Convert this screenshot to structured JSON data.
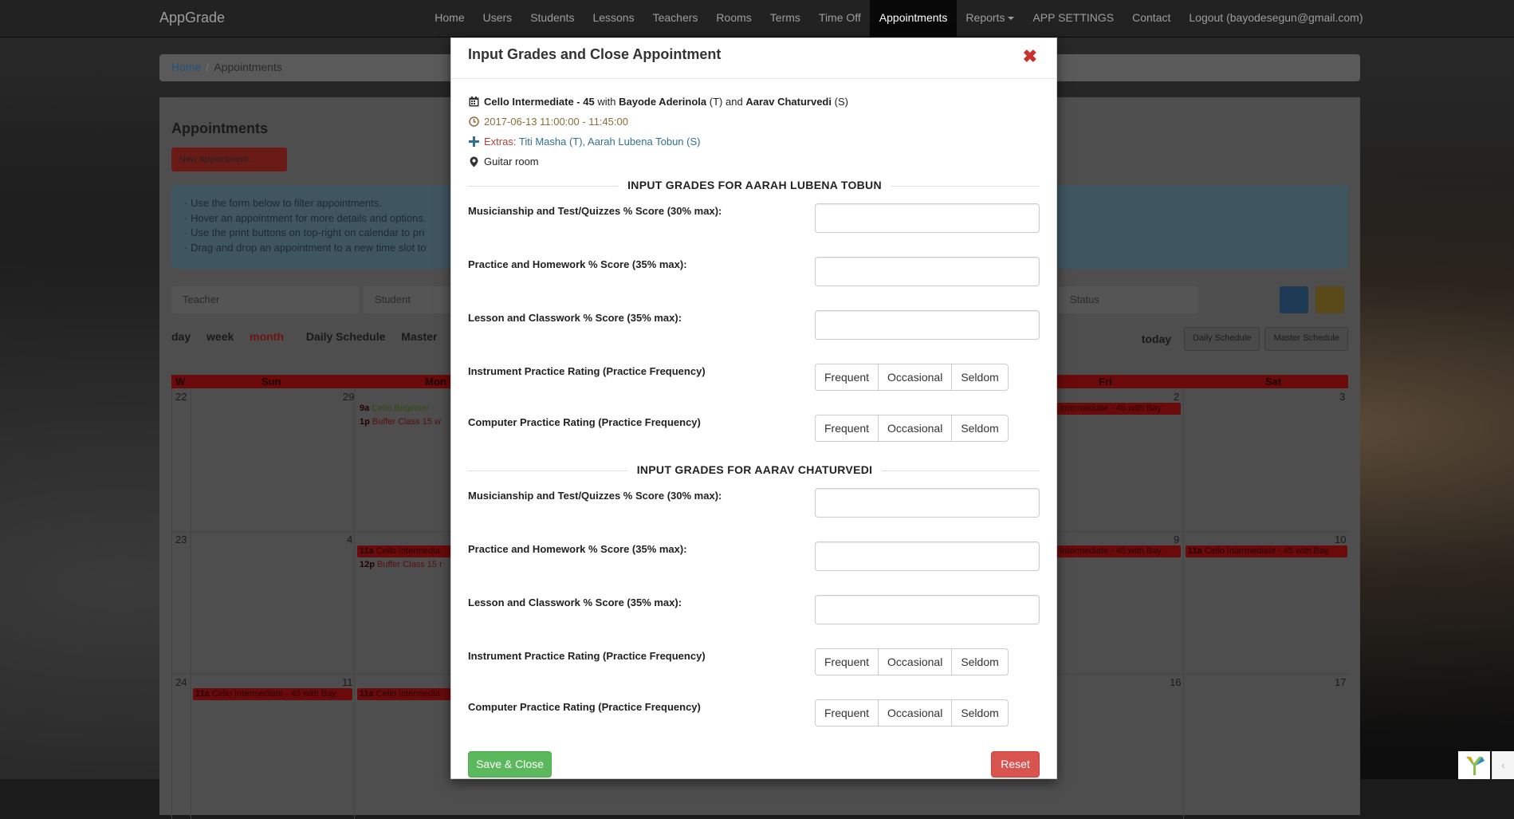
{
  "navbar": {
    "brand": "AppGrade",
    "items": [
      "Home",
      "Users",
      "Students",
      "Lessons",
      "Teachers",
      "Rooms",
      "Terms",
      "Time Off",
      "Appointments",
      "Reports",
      "APP SETTINGS",
      "Contact",
      "Logout (bayodesegun@gmail.com)"
    ]
  },
  "breadcrumb": {
    "home": "Home",
    "current": "Appointments"
  },
  "page": {
    "title": "Appointments",
    "new_button": "New Appointment...",
    "info": [
      "· Use the form below to filter appointments.",
      "· Hover an appointment for more details and options.",
      "· Use the print buttons on top-right on calendar to pri",
      "· Drag and drop an appointment to a new time slot to"
    ],
    "filters": {
      "teacher": "Teacher",
      "student": "Student",
      "status": "Status"
    },
    "views": [
      "day",
      "week",
      "month"
    ],
    "schedule_links": [
      "Daily Schedule",
      "Master"
    ],
    "today": "today",
    "print_buttons": [
      "Daily Schedule",
      "Master Schedule"
    ]
  },
  "calendar": {
    "week_label": "W",
    "days": [
      "Sun",
      "Mon",
      "Fri",
      "Sat"
    ],
    "numbers": [
      "22",
      "29",
      "2",
      "3",
      "23",
      "4",
      "9",
      "10",
      "24",
      "11",
      "16",
      "17"
    ],
    "events": [
      {
        "time": "9a",
        "title": "Cello Beginner -"
      },
      {
        "time": "1p",
        "title": "Buffer Class 15 w"
      },
      {
        "time": "",
        "title": "Intermediate - 45 with Bay"
      },
      {
        "time": "11a",
        "title": "Cello Intermedia"
      },
      {
        "time": "12p",
        "title": "Buffer Class 15 r"
      },
      {
        "time": "",
        "title": "Intermediate - 45 with Bay"
      },
      {
        "time": "11a",
        "title": "Cello Intermediate - 45 with Bay"
      },
      {
        "time": "11a",
        "title": "Cello Intermediate - 45 with Bay"
      },
      {
        "time": "11a",
        "title": "Cello Intermedia"
      }
    ]
  },
  "modal": {
    "title": "Input Grades and Close Appointment",
    "lesson": "Cello Intermediate - 45",
    "with_word": "with",
    "teacher": "Bayode Aderinola",
    "teacher_tag": "(T)",
    "and_word": "and",
    "student": "Aarav Chaturvedi",
    "student_tag": "(S)",
    "datetime": "2017-06-13 11:00:00 - 11:45:00",
    "extras_label": "Extras:",
    "extras_value": "Titi Masha (T), Aarah Lubena Tobun (S)",
    "room": "Guitar room",
    "sections": [
      {
        "heading": "INPUT GRADES FOR AARAH LUBENA TOBUN",
        "fields": [
          {
            "label": "Musicianship and Test/Quizzes % Score (30% max):",
            "value": ""
          },
          {
            "label": "Practice and Homework % Score (35% max):",
            "value": ""
          },
          {
            "label": "Lesson and Classwork % Score (35% max):",
            "value": ""
          }
        ],
        "ratings": [
          {
            "label": "Instrument Practice Rating (Practice Frequency)",
            "options": [
              "Frequent",
              "Occasional",
              "Seldom"
            ]
          },
          {
            "label": "Computer Practice Rating (Practice Frequency)",
            "options": [
              "Frequent",
              "Occasional",
              "Seldom"
            ]
          }
        ]
      },
      {
        "heading": "INPUT GRADES FOR AARAV CHATURVEDI",
        "fields": [
          {
            "label": "Musicianship and Test/Quizzes % Score (30% max):",
            "value": ""
          },
          {
            "label": "Practice and Homework % Score (35% max):",
            "value": ""
          },
          {
            "label": "Lesson and Classwork % Score (35% max):",
            "value": ""
          }
        ],
        "ratings": [
          {
            "label": "Instrument Practice Rating (Practice Frequency)",
            "options": [
              "Frequent",
              "Occasional",
              "Seldom"
            ]
          },
          {
            "label": "Computer Practice Rating (Practice Frequency)",
            "options": [
              "Frequent",
              "Occasional",
              "Seldom"
            ]
          }
        ]
      }
    ],
    "save_button": "Save & Close",
    "reset_button": "Reset"
  },
  "colors": {
    "navbar_bg": "#222222",
    "save_green": "#5cb85c",
    "reset_red": "#d9534f",
    "close_red": "#c9302c",
    "datetime_brown": "#8a6d3b",
    "extras_blue": "#31708f"
  },
  "icons": [
    "calendar-icon",
    "clock-icon",
    "plus-icon",
    "map-marker-icon",
    "close-icon",
    "yii-logo-icon"
  ]
}
